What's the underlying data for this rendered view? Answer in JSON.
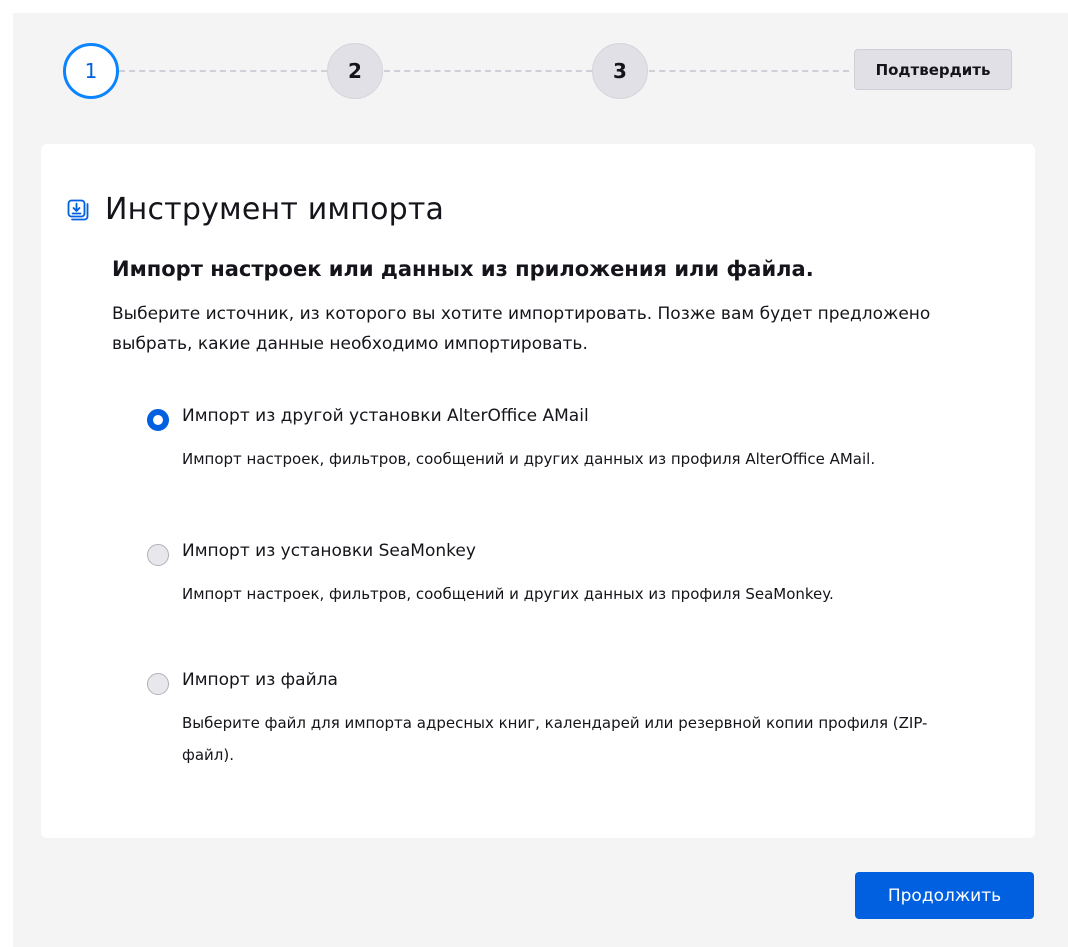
{
  "stepper": {
    "steps": [
      {
        "label": "1",
        "state": "active"
      },
      {
        "label": "2",
        "state": "inactive"
      },
      {
        "label": "3",
        "state": "inactive"
      }
    ],
    "confirm_label": "Подтвердить"
  },
  "card": {
    "icon": "import-icon",
    "title": "Инструмент импорта",
    "subtitle": "Импорт настроек или данных из приложения или файла.",
    "description": "Выберите источник, из которого вы хотите импортировать. Позже вам будет предложено выбрать, какие данные необходимо импортировать.",
    "options": [
      {
        "label": "Импорт из другой установки AlterOffice AMail",
        "description": "Импорт настроек, фильтров, сообщений и других данных из профиля AlterOffice AMail.",
        "checked": true
      },
      {
        "label": "Импорт из установки SeaMonkey",
        "description": "Импорт настроек, фильтров, сообщений и других данных из профиля SeaMonkey.",
        "checked": false
      },
      {
        "label": "Импорт из файла",
        "description": "Выберите файл для импорта адресных книг, календарей или резервной копии профиля (ZIP-файл).",
        "checked": false
      }
    ]
  },
  "footer": {
    "continue_label": "Продолжить"
  },
  "colors": {
    "accent": "#0060df",
    "active_step_ring": "#0a84ff",
    "background": "#f4f4f5",
    "card": "#ffffff"
  }
}
